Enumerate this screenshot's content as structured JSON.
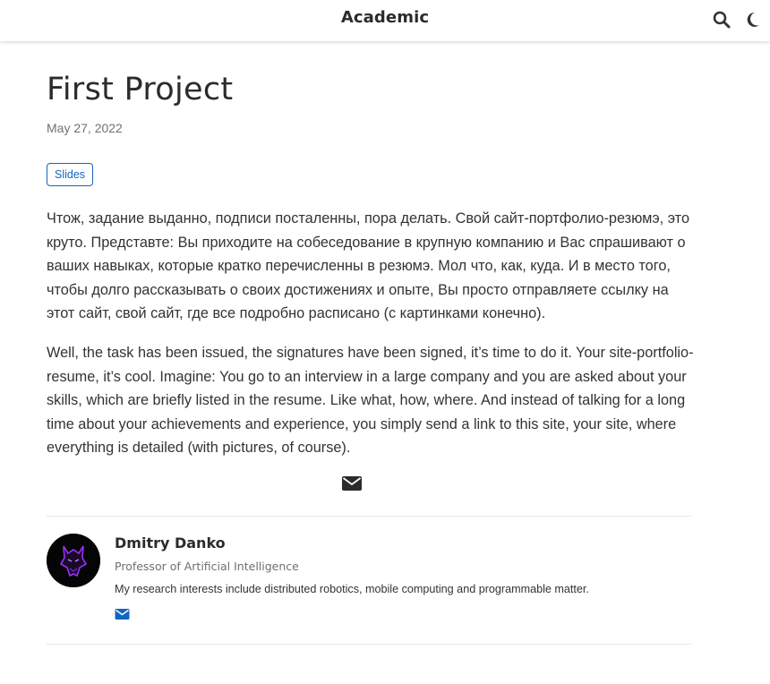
{
  "navbar": {
    "brand": "Academic",
    "icons": [
      "search-icon",
      "moon-icon"
    ]
  },
  "article": {
    "title": "First Project",
    "date": "May 27, 2022",
    "slides_button": "Slides",
    "paragraphs": [
      "Чтож, задание выданно, подписи посталенны, пора делать. Свой сайт-портфолио-резюмэ, это круто. Представте: Вы приходите на собеседование в крупную компанию и Вас спрашивают о ваших навыках, которые кратко перечисленны в резюмэ. Мол что, как, куда. И в место того, чтобы долго рассказывать о своих достижениях и опыте, Вы просто отправляете ссылку на этот сайт, свой сайт, где все подробно расписано (с картинками конечно).",
      "Well, the task has been issued, the signatures have been signed, it’s time to do it. Your site-portfolio-resume, it’s cool. Imagine: You go to an interview in a large company and you are asked about your skills, which are briefly listed in the resume. Like what, how, where. And instead of talking for a long time about your achievements and experience, you simply send a link to this site, your site, where everything is detailed (with pictures, of course)."
    ],
    "share_icon": "envelope-icon"
  },
  "author": {
    "name": "Dmitry Danko",
    "role": "Professor of Artificial Intelligence",
    "bio": "My research interests include distributed robotics, mobile computing and programmable matter.",
    "avatar_icon": "wolf-avatar",
    "contact_icon": "envelope-icon"
  },
  "colors": {
    "accent": "#1565c0",
    "text": "#333333",
    "muted": "#707070",
    "avatar_glow": "#8a2be2"
  }
}
